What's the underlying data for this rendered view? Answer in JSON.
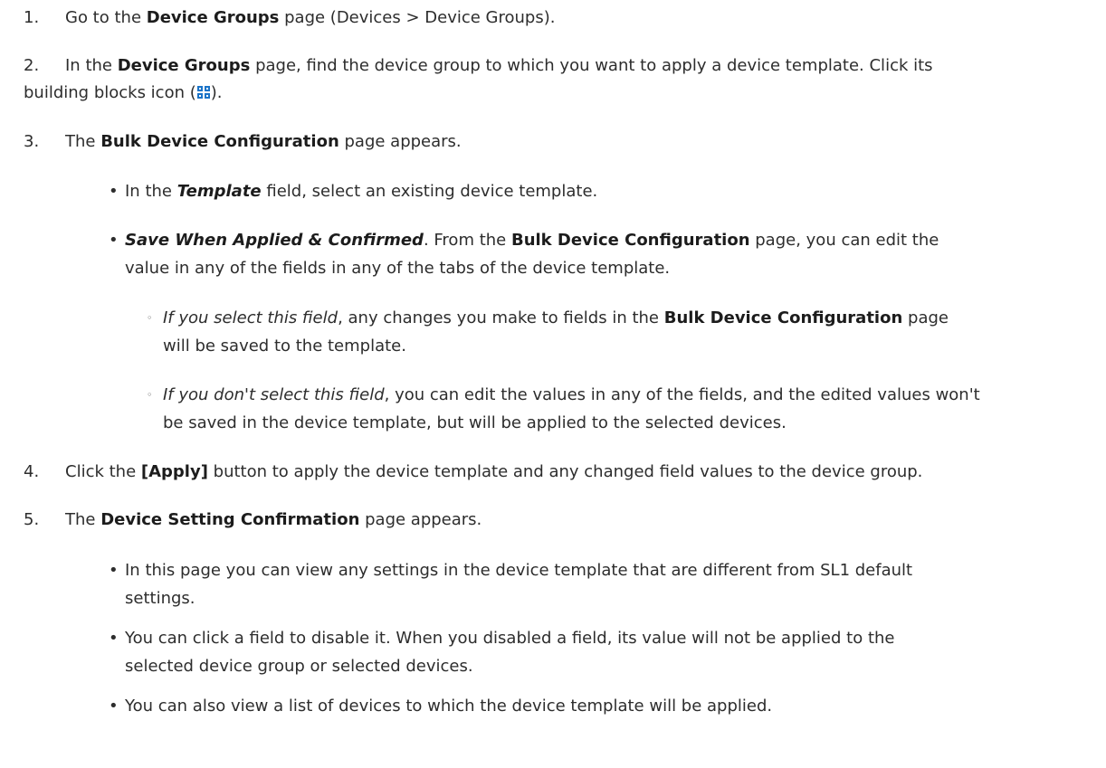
{
  "steps": [
    {
      "num": "1.",
      "parts": [
        "Go to the ",
        "Device Groups",
        " page (Devices > Device Groups)."
      ]
    },
    {
      "num": "2.",
      "parts": [
        "In the ",
        "Device Groups",
        " page, find the device group to which you want to apply a device template. Click its",
        "building blocks icon (",
        ")."
      ],
      "icon": "building-blocks-icon"
    },
    {
      "num": "3.",
      "parts": [
        "The ",
        "Bulk Device Configuration",
        " page appears."
      ],
      "bullets": [
        {
          "parts": [
            "In the ",
            "Template",
            " field, select an existing device template."
          ]
        },
        {
          "parts": [
            "Save When Applied & Confirmed",
            ". From the ",
            "Bulk Device Configuration",
            " page, you can edit the",
            "value in any of the fields in any of the tabs of the device template."
          ],
          "subs": [
            {
              "parts": [
                "If you select this field",
                ", any changes you make to fields in the ",
                "Bulk Device Configuration",
                " page",
                "will be saved to the template."
              ]
            },
            {
              "parts": [
                "If you don't select this field",
                ", you can edit the values in any of the fields, and the edited values won't",
                "be saved in the device template, but will be applied to the selected devices."
              ]
            }
          ]
        }
      ]
    },
    {
      "num": "4.",
      "parts": [
        "Click the ",
        "[Apply]",
        " button to apply the device template and any changed field values to the device group."
      ]
    },
    {
      "num": "5.",
      "parts": [
        "The ",
        "Device Setting Confirmation",
        " page appears."
      ],
      "bullets": [
        {
          "parts": [
            "In this page you can view any settings in the device template that are different from SL1 default",
            "settings."
          ]
        },
        {
          "parts": [
            "You can click a field to disable it. When you disabled a field, its value will not be applied to the",
            "selected device group or selected devices."
          ]
        },
        {
          "parts": [
            "You can also view a list of devices to which the device template will be applied."
          ]
        }
      ]
    }
  ],
  "markers": {
    "bullet": "•",
    "sub_bullet": "◦"
  },
  "colors": {
    "text": "#2d2d2d",
    "icon_blue": "#1a73c8"
  }
}
